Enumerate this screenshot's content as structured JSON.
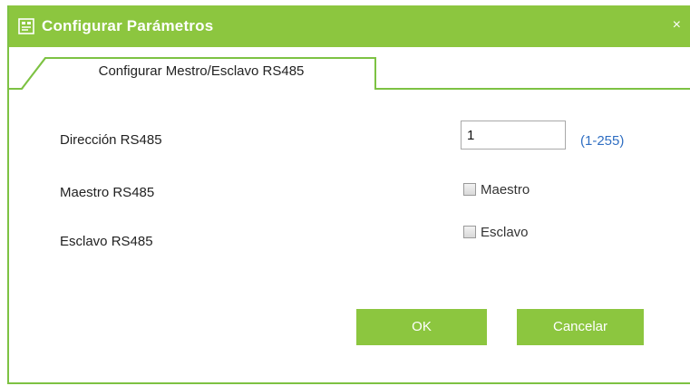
{
  "dialog": {
    "title": "Configurar Parámetros",
    "close_glyph": "×",
    "accent_color": "#8cc63f"
  },
  "tabs": [
    {
      "label": "Configurar Mestro/Esclavo RS485",
      "active": true
    }
  ],
  "form": {
    "address_label": "Dirección RS485",
    "address_value": "1",
    "address_range": "(1-255)",
    "master_label": "Maestro RS485",
    "master_checkbox_label": "Maestro",
    "master_checked": false,
    "slave_label": "Esclavo RS485",
    "slave_checkbox_label": "Esclavo",
    "slave_checked": false
  },
  "buttons": {
    "ok_label": "OK",
    "cancel_label": "Cancelar"
  },
  "icons": {
    "title": "settings-dialog-icon",
    "close": "close-icon"
  }
}
